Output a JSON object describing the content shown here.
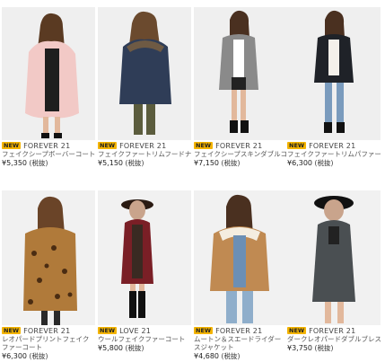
{
  "badge_label": "NEW",
  "products": [
    {
      "brand": "FOREVER 21",
      "name": "フェイクシープボーバーコート",
      "price": "¥5,350",
      "tax": "(税抜)"
    },
    {
      "brand": "FOREVER 21",
      "name": "フェイクファートリムフードナイロンジャケット",
      "price": "¥5,150",
      "tax": "(税抜)"
    },
    {
      "brand": "FOREVER 21",
      "name": "フェイクシープスキンダブルコート",
      "price": "¥7,150",
      "tax": "(税抜)"
    },
    {
      "brand": "FOREVER 21",
      "name": "フェイクファートリムパファージャケット",
      "price": "¥6,300",
      "tax": "(税抜)"
    },
    {
      "brand": "FOREVER 21",
      "name": "レオパードプリントフェイクファーコート",
      "price": "¥6,300",
      "tax": "(税抜)"
    },
    {
      "brand": "LOVE 21",
      "name": "ウールフェイクファーコート",
      "price": "¥5,800",
      "tax": "(税抜)"
    },
    {
      "brand": "FOREVER 21",
      "name": "ムートン＆スエードライダースジャケット",
      "price": "¥4,680",
      "tax": "(税抜)"
    },
    {
      "brand": "FOREVER 21",
      "name": "ダークレオパードダブルブレストコート",
      "price": "¥3,750",
      "tax": "(税抜)"
    }
  ],
  "colors": {
    "badge": "#f4b400",
    "coat_pink": "#f2c9c6",
    "coat_navy": "#2f3d57",
    "coat_grey": "#8a8a8a",
    "coat_black": "#1f2228",
    "coat_leopard": "#b07a3a",
    "coat_burgundy": "#7a1f26",
    "coat_tan": "#c08a52",
    "coat_darkgrey": "#4a4f52"
  }
}
